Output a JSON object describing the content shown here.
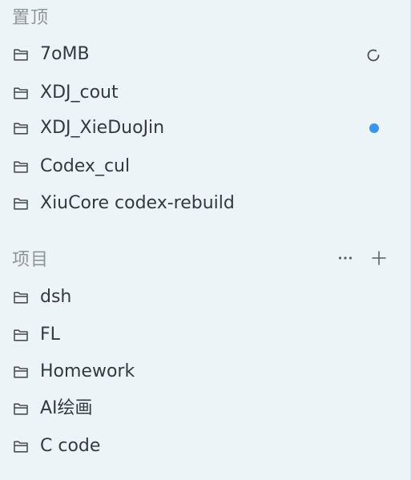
{
  "pinned": {
    "title": "置顶",
    "items": [
      {
        "label": "7oMB",
        "status": "loading-spinner-icon"
      },
      {
        "label": "XDJ_cout",
        "status": ""
      },
      {
        "label": "XDJ_XieDuoJin",
        "status": "unread-dot-icon"
      },
      {
        "label": "Codex_cul",
        "status": ""
      },
      {
        "label": "XiuCore codex-rebuild",
        "status": ""
      }
    ]
  },
  "projects": {
    "title": "项目",
    "more_icon": "more-horizontal-icon",
    "add_icon": "plus-icon",
    "items": [
      {
        "label": "dsh"
      },
      {
        "label": "FL"
      },
      {
        "label": "Homework"
      },
      {
        "label": "AI绘画"
      },
      {
        "label": "C code"
      }
    ]
  },
  "colors": {
    "background": "#edf4f8",
    "muted_text": "#8e9498",
    "primary_text": "#333a3f",
    "icon": "#4a4f53",
    "accent_dot": "#3b95ee"
  }
}
